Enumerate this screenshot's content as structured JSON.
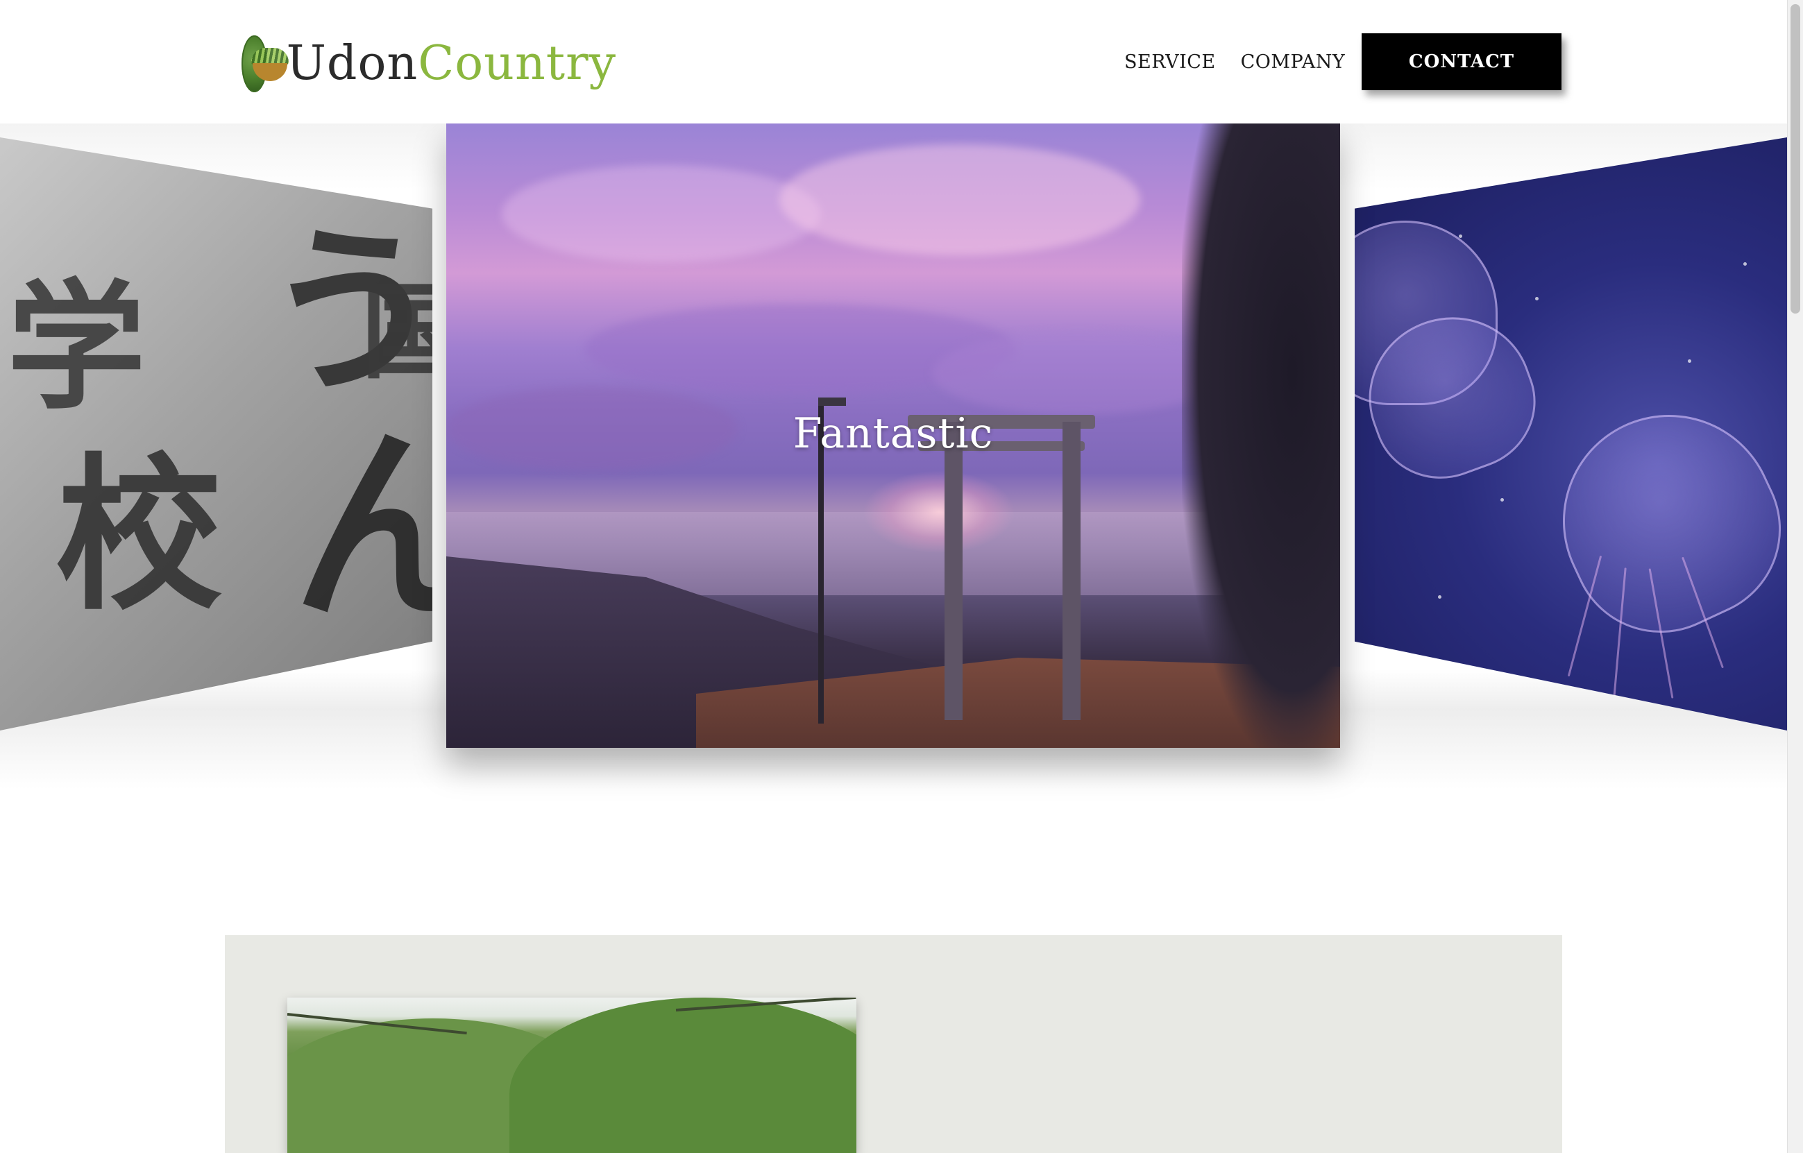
{
  "header": {
    "logo_part1": "Udon",
    "logo_part2": "Country",
    "nav": [
      {
        "label": "SERVICE"
      },
      {
        "label": "COMPANY"
      }
    ],
    "contact_label": "CONTACT"
  },
  "carousel": {
    "active_slide": {
      "title": "Fantastic"
    },
    "left_slide_icon": "calligraphy-sign",
    "right_slide_icon": "jellyfish"
  },
  "colors": {
    "logo_green": "#8bb73f",
    "contact_bg": "#000000",
    "section_bg": "#e8e9e4"
  }
}
